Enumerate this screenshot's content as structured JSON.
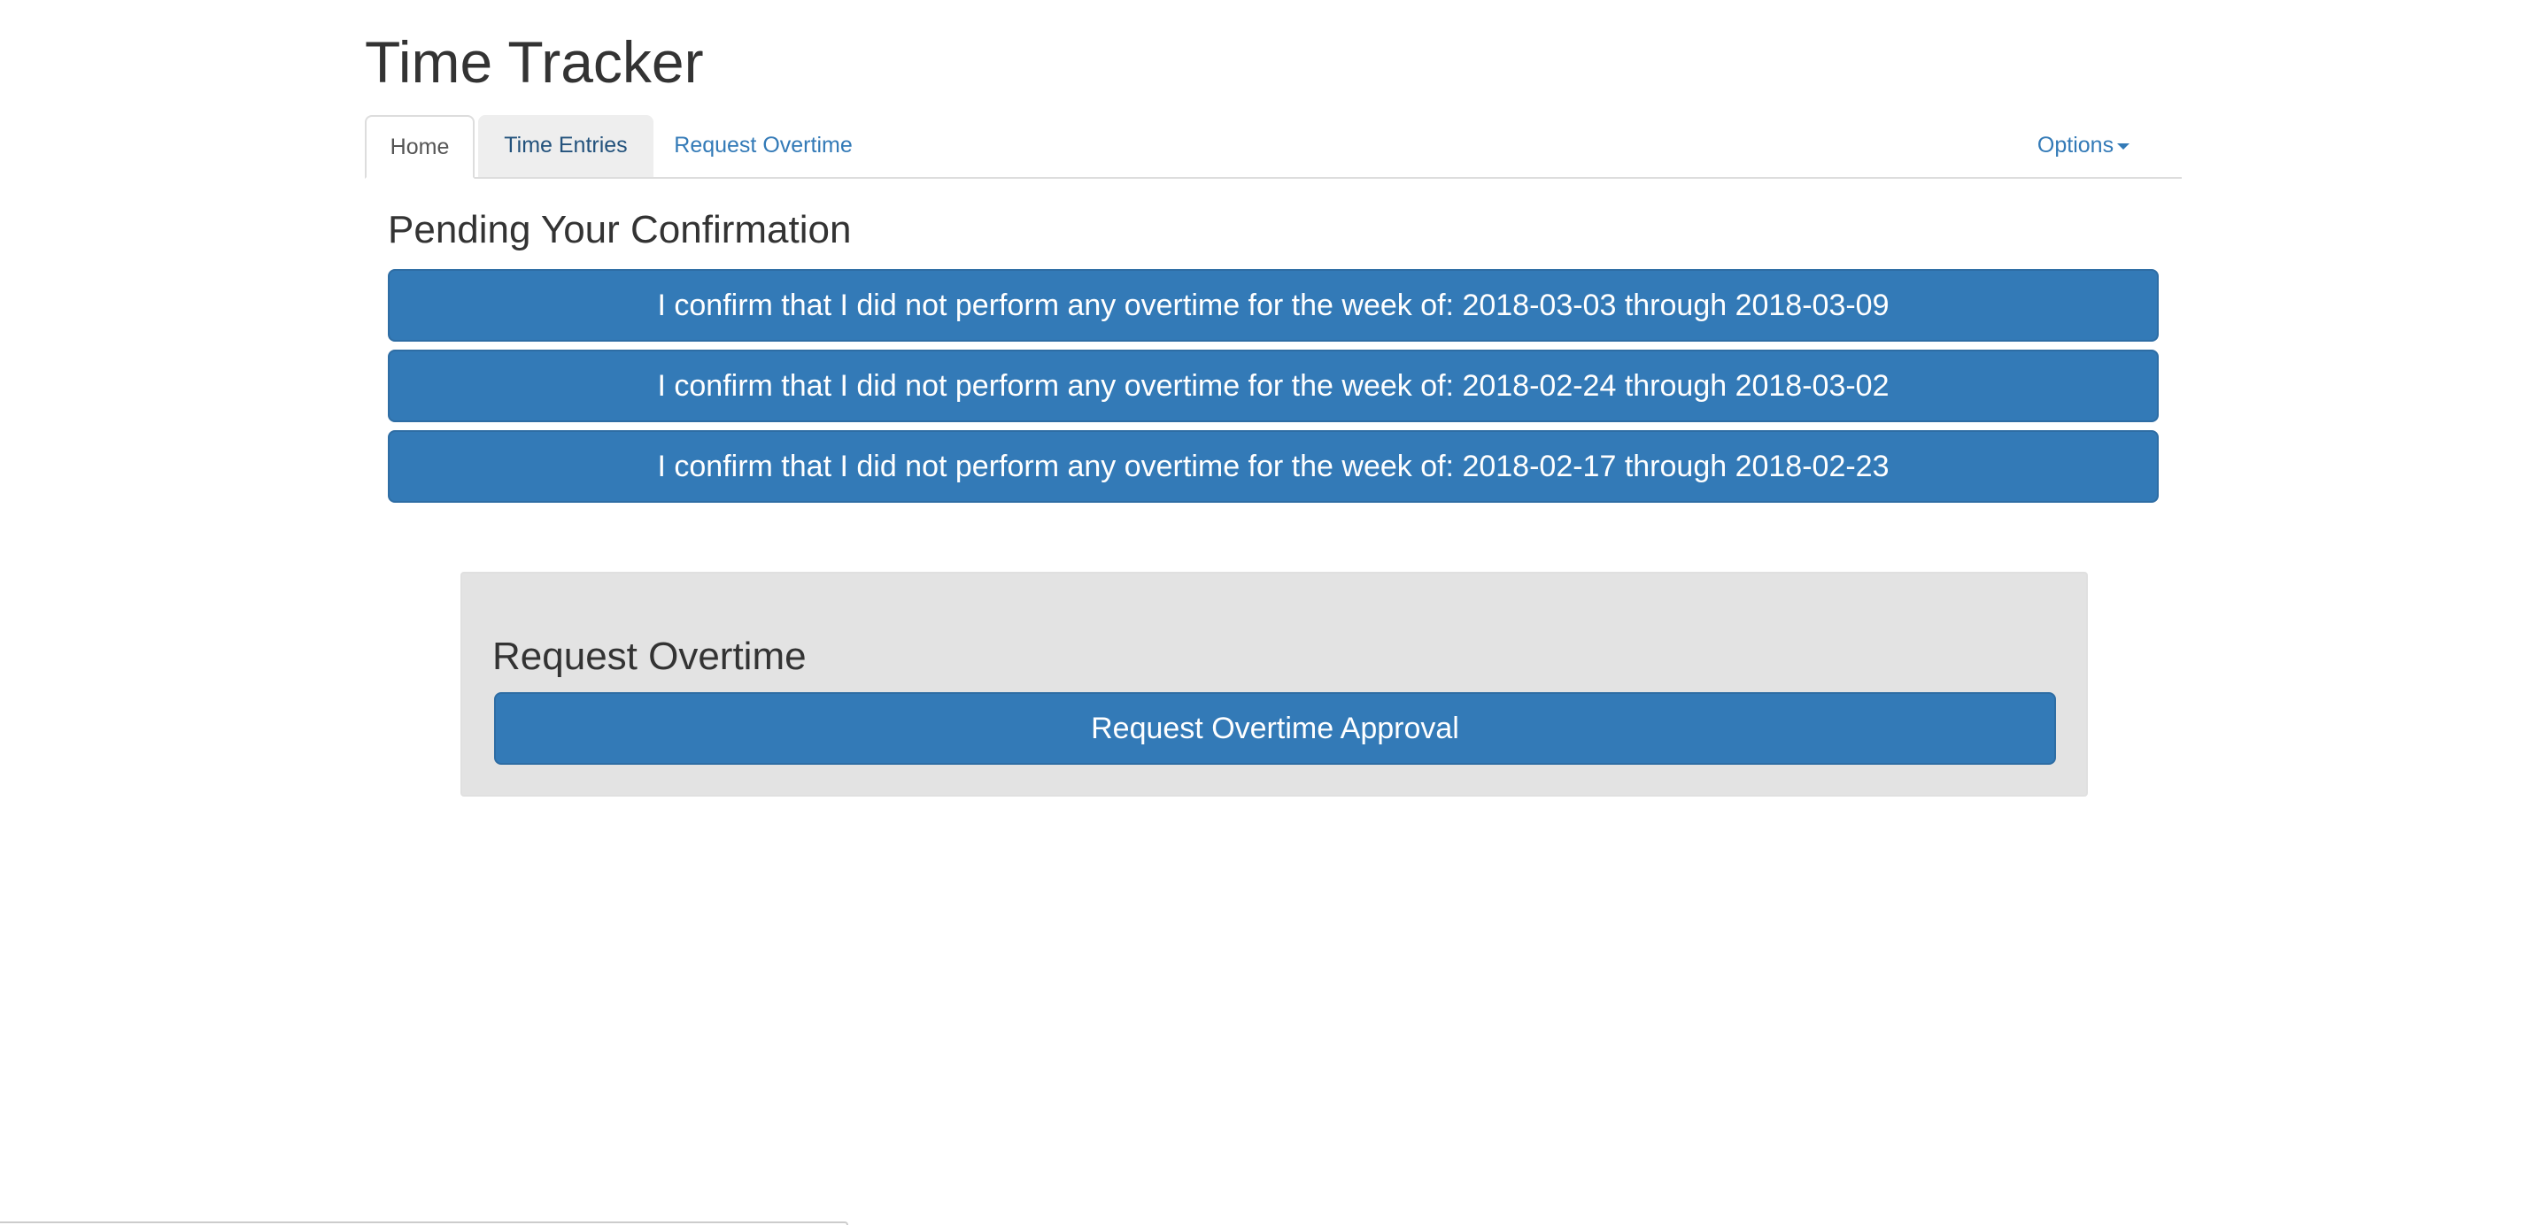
{
  "app": {
    "title": "Time Tracker"
  },
  "nav": {
    "tabs": [
      {
        "label": "Home",
        "active": true
      },
      {
        "label": "Time Entries",
        "active": false
      },
      {
        "label": "Request Overtime",
        "active": false
      }
    ],
    "options_label": "Options"
  },
  "pending": {
    "title": "Pending Your Confirmation",
    "items": [
      {
        "label": "I confirm that I did not perform any overtime for the week of: 2018-03-03 through 2018-03-09"
      },
      {
        "label": "I confirm that I did not perform any overtime for the week of: 2018-02-24 through 2018-03-02"
      },
      {
        "label": "I confirm that I did not perform any overtime for the week of: 2018-02-17 through 2018-02-23"
      }
    ]
  },
  "request_overtime": {
    "title": "Request Overtime",
    "button_label": "Request Overtime Approval"
  },
  "colors": {
    "primary": "#337ab7",
    "primary_border": "#2e6da4",
    "link": "#337ab7",
    "well_background": "#e3e3e3",
    "text": "#333333"
  }
}
